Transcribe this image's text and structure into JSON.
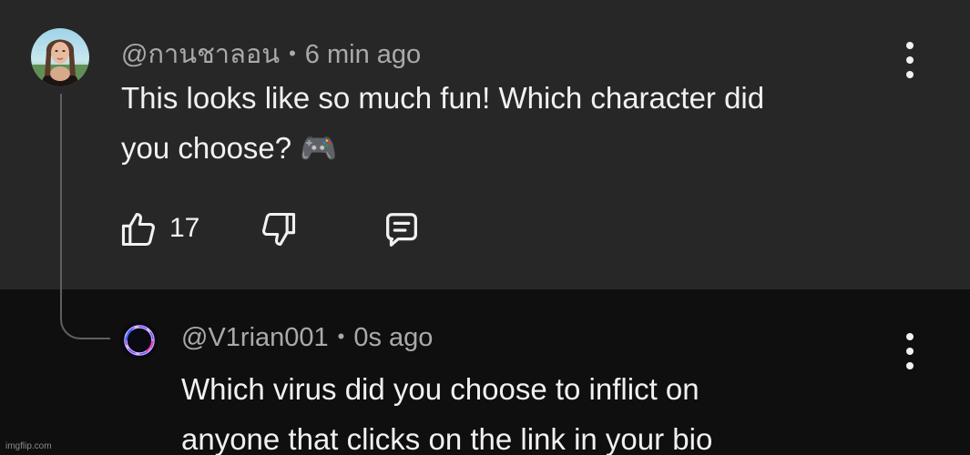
{
  "comment": {
    "handle": "@กานชาลอน",
    "separator": "•",
    "time": "6 min ago",
    "text_line1": "This looks like so much fun! Which character did",
    "text_line2": "you choose?",
    "emoji": "🎮",
    "like_count": "17",
    "icons": [
      "avatar",
      "thumbs-up-icon",
      "thumbs-down-icon",
      "reply-comment-icon",
      "more-vert-icon"
    ]
  },
  "reply": {
    "handle": "@V1rian001",
    "separator": "•",
    "time": "0s ago",
    "text_line1": "Which virus did you choose to inflict on",
    "text_line2": "anyone that clicks on the link in your bio",
    "icons": [
      "ring-avatar",
      "more-vert-icon"
    ]
  },
  "colors": {
    "comment_bg": "#272727",
    "reply_bg": "#0f0f0f",
    "text_primary": "#f1f1f1",
    "text_secondary": "#aaaaaa",
    "ring_accent": "#7b4dff"
  },
  "watermark": "imgflip.com"
}
